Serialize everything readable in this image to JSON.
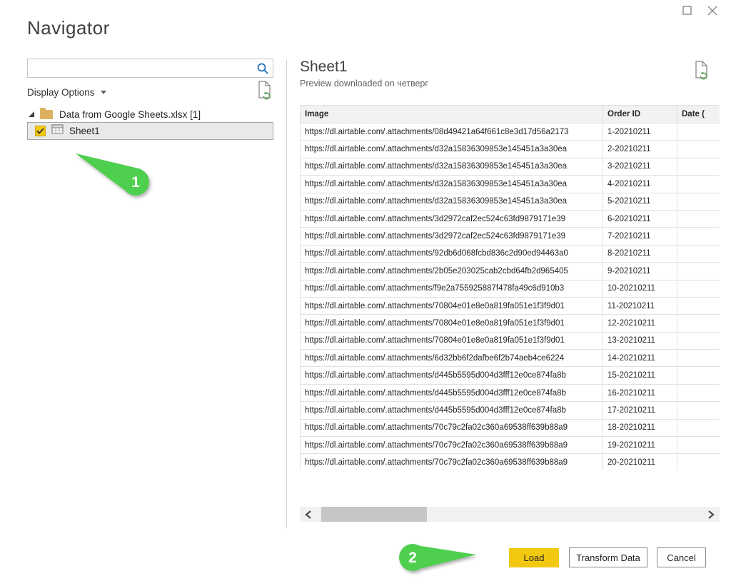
{
  "window": {
    "title": "Navigator",
    "controls": {
      "maximize": "maximize",
      "close": "close"
    }
  },
  "left_panel": {
    "search": {
      "value": "",
      "placeholder": ""
    },
    "display_options_label": "Display Options",
    "tree": {
      "root_label": "Data from Google Sheets.xlsx [1]",
      "items": [
        {
          "label": "Sheet1",
          "checked": true,
          "selected": true
        }
      ]
    }
  },
  "preview": {
    "title": "Sheet1",
    "subtitle": "Preview downloaded on четверг",
    "table": {
      "columns": [
        "Image",
        "Order ID",
        "Date ("
      ],
      "rows": [
        [
          "https://dl.airtable.com/.attachments/08d49421a64f661c8e3d17d56a2173",
          "1-20210211",
          ""
        ],
        [
          "https://dl.airtable.com/.attachments/d32a15836309853e145451a3a30ea",
          "2-20210211",
          ""
        ],
        [
          "https://dl.airtable.com/.attachments/d32a15836309853e145451a3a30ea",
          "3-20210211",
          ""
        ],
        [
          "https://dl.airtable.com/.attachments/d32a15836309853e145451a3a30ea",
          "4-20210211",
          ""
        ],
        [
          "https://dl.airtable.com/.attachments/d32a15836309853e145451a3a30ea",
          "5-20210211",
          ""
        ],
        [
          "https://dl.airtable.com/.attachments/3d2972caf2ec524c63fd9879171e39",
          "6-20210211",
          ""
        ],
        [
          "https://dl.airtable.com/.attachments/3d2972caf2ec524c63fd9879171e39",
          "7-20210211",
          ""
        ],
        [
          "https://dl.airtable.com/.attachments/92db6d068fcbd836c2d90ed94463a0",
          "8-20210211",
          ""
        ],
        [
          "https://dl.airtable.com/.attachments/2b05e203025cab2cbd64fb2d965405",
          "9-20210211",
          ""
        ],
        [
          "https://dl.airtable.com/.attachments/f9e2a755925887f478fa49c6d910b3",
          "10-20210211",
          ""
        ],
        [
          "https://dl.airtable.com/.attachments/70804e01e8e0a819fa051e1f3f9d01",
          "11-20210211",
          ""
        ],
        [
          "https://dl.airtable.com/.attachments/70804e01e8e0a819fa051e1f3f9d01",
          "12-20210211",
          ""
        ],
        [
          "https://dl.airtable.com/.attachments/70804e01e8e0a819fa051e1f3f9d01",
          "13-20210211",
          ""
        ],
        [
          "https://dl.airtable.com/.attachments/6d32bb6f2dafbe6f2b74aeb4ce6224",
          "14-20210211",
          ""
        ],
        [
          "https://dl.airtable.com/.attachments/d445b5595d004d3fff12e0ce874fa8b",
          "15-20210211",
          ""
        ],
        [
          "https://dl.airtable.com/.attachments/d445b5595d004d3fff12e0ce874fa8b",
          "16-20210211",
          ""
        ],
        [
          "https://dl.airtable.com/.attachments/d445b5595d004d3fff12e0ce874fa8b",
          "17-20210211",
          ""
        ],
        [
          "https://dl.airtable.com/.attachments/70c79c2fa02c360a69538ff639b88a9",
          "18-20210211",
          ""
        ],
        [
          "https://dl.airtable.com/.attachments/70c79c2fa02c360a69538ff639b88a9",
          "19-20210211",
          ""
        ],
        [
          "https://dl.airtable.com/.attachments/70c79c2fa02c360a69538ff639b88a9",
          "20-20210211",
          ""
        ]
      ]
    }
  },
  "footer": {
    "load_label": "Load",
    "transform_label": "Transform Data",
    "cancel_label": "Cancel"
  },
  "annotations": {
    "step1": {
      "label": "1"
    },
    "step2": {
      "label": "2"
    }
  },
  "icons": {
    "search": "magnifier",
    "refresh_preview": "document-refresh",
    "expand_caret": "triangle-expanded",
    "folder": "folder",
    "sheet": "worksheet-grid",
    "checkbox": "checked-yellow",
    "maximize": "square-outline",
    "close": "x-cross"
  },
  "colors": {
    "accent_yellow": "#f2c811",
    "annotation_green": "#4ed04e",
    "search_blue": "#1f6cb5",
    "refresh_green": "#57a557",
    "folder_tan": "#deb161",
    "selected_row_bg": "#e9e9e9"
  }
}
